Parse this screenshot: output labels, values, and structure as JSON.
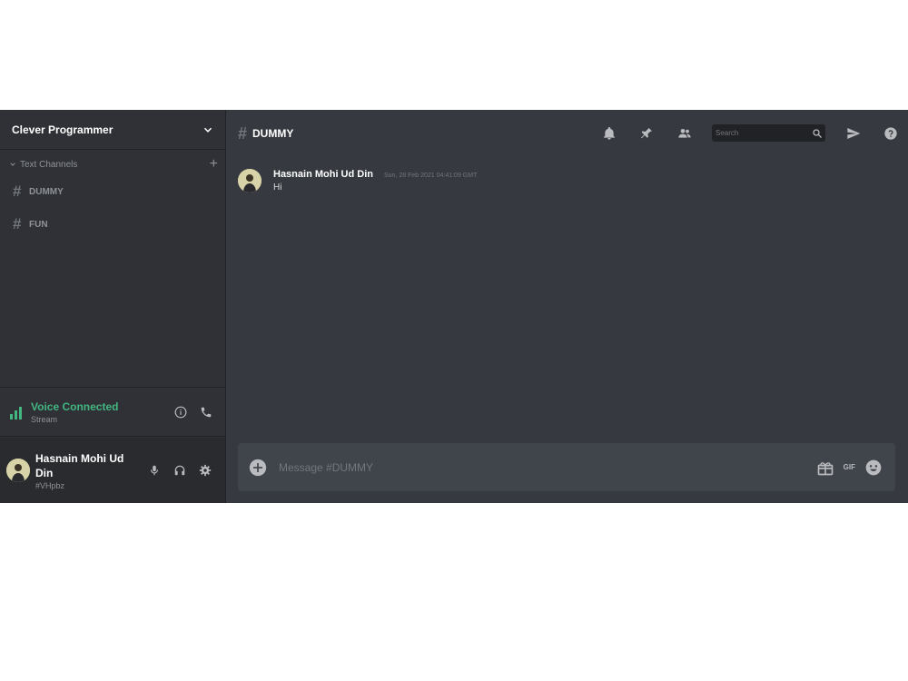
{
  "server": {
    "name": "Clever Programmer"
  },
  "sidebar": {
    "section_title": "Text Channels",
    "channels": [
      {
        "name": "DUMMY"
      },
      {
        "name": "FUN"
      }
    ]
  },
  "voice": {
    "status": "Voice Connected",
    "sub": "Stream"
  },
  "user": {
    "name": "Hasnain Mohi Ud Din",
    "tag": "#VHpbz"
  },
  "chat": {
    "channel_name": "DUMMY",
    "search_placeholder": "Search",
    "messages": [
      {
        "author": "Hasnain Mohi Ud Din",
        "timestamp": "Sun, 28 Feb 2021 04:41:09 GMT",
        "text": "Hi"
      }
    ],
    "composer_placeholder": "Message #DUMMY",
    "gif_label": "GIF"
  },
  "colors": {
    "sidebar_bg": "#2f3136",
    "main_bg": "#36393f",
    "user_panel_bg": "#292b2f",
    "composer_bg": "#40444b",
    "voice_green": "#43b581"
  },
  "icons": [
    "chevron-down-icon",
    "plus-icon",
    "hash-icon",
    "signal-icon",
    "info-icon",
    "phone-icon",
    "mic-icon",
    "headphones-icon",
    "gear-icon",
    "bell-icon",
    "pin-icon",
    "members-icon",
    "search-icon",
    "send-icon",
    "help-icon",
    "add-circle-icon",
    "gift-icon",
    "emoji-icon"
  ]
}
